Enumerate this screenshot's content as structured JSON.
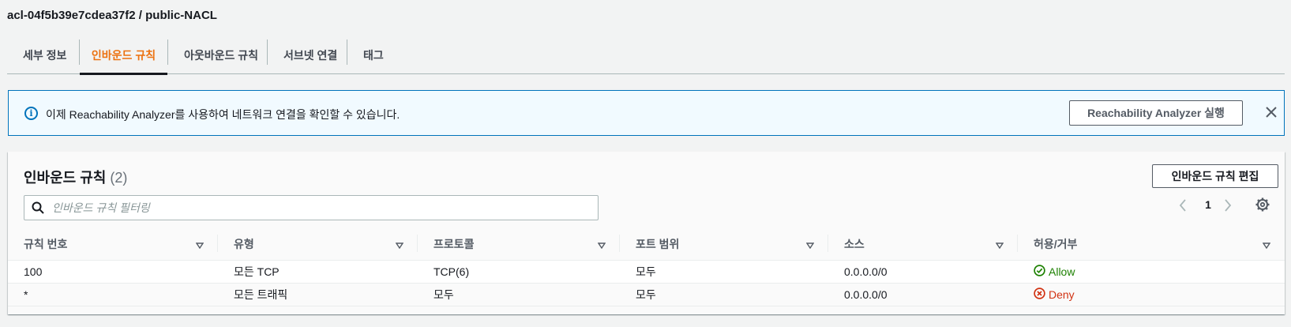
{
  "page": {
    "title": "acl-04f5b39e7cdea37f2 / public-NACL"
  },
  "tabs": [
    {
      "label": "세부 정보",
      "active": false
    },
    {
      "label": "인바운드 규칙",
      "active": true
    },
    {
      "label": "아웃바운드 규칙",
      "active": false
    },
    {
      "label": "서브넷 연결",
      "active": false
    },
    {
      "label": "태그",
      "active": false
    }
  ],
  "flash": {
    "message": "이제 Reachability Analyzer를 사용하여 네트워크 연결을 확인할 수 있습니다.",
    "button_label": "Reachability Analyzer 실행",
    "icon": "info-icon",
    "close_icon": "close-icon"
  },
  "panel": {
    "title": "인바운드 규칙",
    "count": "(2)",
    "edit_button_label": "인바운드 규칙 편집",
    "search_placeholder": "인바운드 규칙 필터링",
    "page_number": "1"
  },
  "table": {
    "columns": [
      "규칙 번호",
      "유형",
      "프로토콜",
      "포트 범위",
      "소스",
      "허용/거부"
    ],
    "rows": [
      {
        "rule_number": "100",
        "type": "모든 TCP",
        "protocol": "TCP(6)",
        "port_range": "모두",
        "source": "0.0.0.0/0",
        "action": "Allow",
        "action_status": "allow"
      },
      {
        "rule_number": "*",
        "type": "모든 트래픽",
        "protocol": "모두",
        "port_range": "모두",
        "source": "0.0.0.0/0",
        "action": "Deny",
        "action_status": "deny"
      }
    ]
  },
  "colors": {
    "accent_active_tab": "#ec7211",
    "info_blue": "#0073bb",
    "allow_green": "#1d8102",
    "deny_red": "#d13212"
  }
}
